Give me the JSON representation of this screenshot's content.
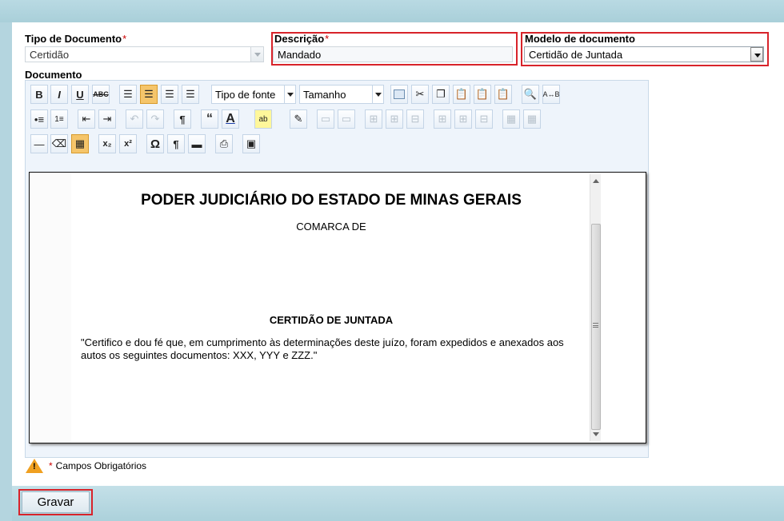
{
  "form": {
    "tipo_label": "Tipo de Documento",
    "tipo_value": "Certidão",
    "descricao_label": "Descrição",
    "descricao_value": "Mandado",
    "modelo_label": "Modelo de documento",
    "modelo_value": "Certidão de Juntada",
    "documento_label": "Documento",
    "required_mark": "*"
  },
  "toolbar": {
    "font_select": "Tipo de fonte",
    "size_select": "Tamanho"
  },
  "document": {
    "title": "PODER JUDICIÁRIO DO ESTADO DE MINAS GERAIS",
    "comarca": "COMARCA DE",
    "certidao_title": "CERTIDÃO DE JUNTADA",
    "paragraph": "\"Certifico e dou fé que, em cumprimento às determinações deste juízo, foram expedidos e anexados aos autos os seguintes documentos: XXX, YYY e ZZZ.\""
  },
  "footer": {
    "required_note": "Campos Obrigatórios",
    "save_label": "Gravar"
  },
  "colors": {
    "highlight": "#d8232a",
    "background": "#b4d5df"
  }
}
